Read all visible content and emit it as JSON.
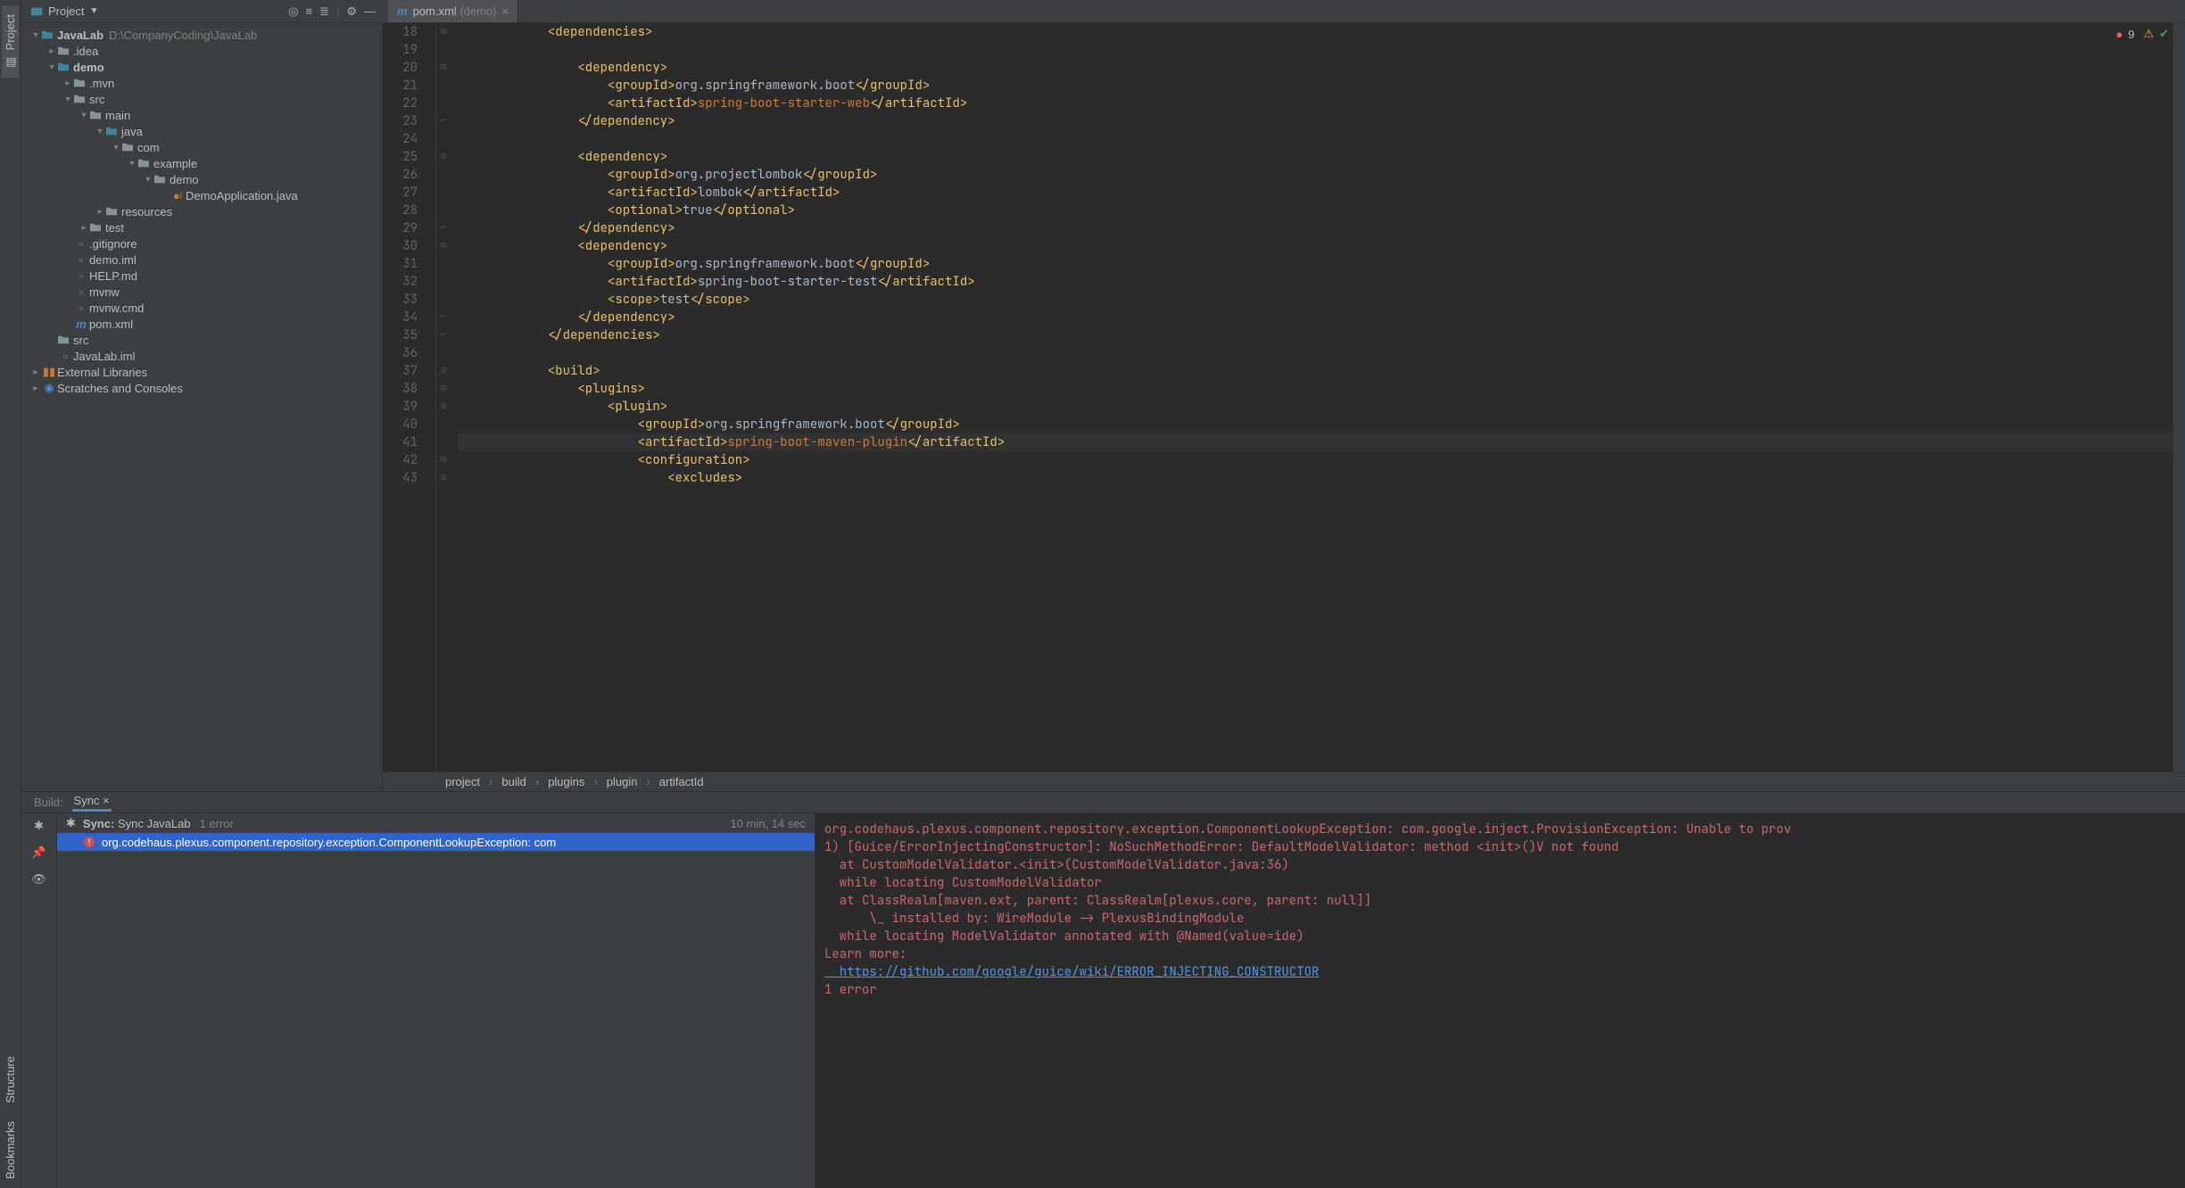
{
  "left_toolbar": {
    "project": "Project",
    "structure": "Structure",
    "bookmarks": "Bookmarks"
  },
  "topbar": {
    "project_label": "Project",
    "tab": {
      "file": "pom.xml",
      "suffix": "(demo)"
    }
  },
  "inspections": {
    "err_count": "9"
  },
  "tree": {
    "root": {
      "name": "JavaLab",
      "path": "D:\\CompanyCoding\\JavaLab"
    },
    "idea": ".idea",
    "demo": "demo",
    "mvn": ".mvn",
    "src": "src",
    "main": "main",
    "java": "java",
    "com": "com",
    "example": "example",
    "demo2": "demo",
    "demoapp": "DemoApplication.java",
    "resources": "resources",
    "test": "test",
    "gitignore": ".gitignore",
    "demoiml": "demo.iml",
    "help": "HELP.md",
    "mvnw": "mvnw",
    "mvnwcmd": "mvnw.cmd",
    "pom": "pom.xml",
    "src2": "src",
    "javalabiml": "JavaLab.iml",
    "extlib": "External Libraries",
    "scratches": "Scratches and Consoles"
  },
  "editor": {
    "lines": [
      {
        "n": 18,
        "indent": 3,
        "tokens": [
          {
            "t": "tag",
            "s": "<dependencies>"
          }
        ]
      },
      {
        "n": 19,
        "indent": 4,
        "tokens": [],
        "partial": true
      },
      {
        "n": 20,
        "indent": 4,
        "tokens": [
          {
            "t": "tag",
            "s": "<dependency>"
          }
        ]
      },
      {
        "n": 21,
        "indent": 5,
        "tokens": [
          {
            "t": "tag",
            "s": "<groupId>"
          },
          {
            "t": "val",
            "s": "org.springframework.boot"
          },
          {
            "t": "tag",
            "s": "</groupId>"
          }
        ]
      },
      {
        "n": 22,
        "indent": 5,
        "tokens": [
          {
            "t": "tag",
            "s": "<artifactId>"
          },
          {
            "t": "hl-orange",
            "s": "spring-boot-starter-web"
          },
          {
            "t": "tag",
            "s": "</artifactId>"
          }
        ]
      },
      {
        "n": 23,
        "indent": 4,
        "tokens": [
          {
            "t": "tag",
            "s": "</dependency>"
          }
        ]
      },
      {
        "n": 24,
        "indent": 0,
        "tokens": []
      },
      {
        "n": 25,
        "indent": 4,
        "tokens": [
          {
            "t": "tag",
            "s": "<dependency>"
          }
        ]
      },
      {
        "n": 26,
        "indent": 5,
        "tokens": [
          {
            "t": "tag",
            "s": "<groupId>"
          },
          {
            "t": "val",
            "s": "org.projectlombok"
          },
          {
            "t": "tag",
            "s": "</groupId>"
          }
        ]
      },
      {
        "n": 27,
        "indent": 5,
        "tokens": [
          {
            "t": "tag",
            "s": "<artifactId>"
          },
          {
            "t": "val",
            "s": "lombok"
          },
          {
            "t": "tag",
            "s": "</artifactId>"
          }
        ]
      },
      {
        "n": 28,
        "indent": 5,
        "tokens": [
          {
            "t": "tag",
            "s": "<optional>"
          },
          {
            "t": "val",
            "s": "true"
          },
          {
            "t": "tag",
            "s": "</optional>"
          }
        ]
      },
      {
        "n": 29,
        "indent": 4,
        "tokens": [
          {
            "t": "tag",
            "s": "</dependency>"
          }
        ]
      },
      {
        "n": 30,
        "indent": 4,
        "tokens": [
          {
            "t": "tag",
            "s": "<dependency>"
          }
        ]
      },
      {
        "n": 31,
        "indent": 5,
        "tokens": [
          {
            "t": "tag",
            "s": "<groupId>"
          },
          {
            "t": "val",
            "s": "org.springframework.boot"
          },
          {
            "t": "tag",
            "s": "</groupId>"
          }
        ]
      },
      {
        "n": 32,
        "indent": 5,
        "tokens": [
          {
            "t": "tag",
            "s": "<artifactId>"
          },
          {
            "t": "val",
            "s": "spring-boot-starter-test"
          },
          {
            "t": "tag",
            "s": "</artifactId>"
          }
        ]
      },
      {
        "n": 33,
        "indent": 5,
        "tokens": [
          {
            "t": "tag",
            "s": "<scope>"
          },
          {
            "t": "val",
            "s": "test"
          },
          {
            "t": "tag",
            "s": "</scope>"
          }
        ]
      },
      {
        "n": 34,
        "indent": 4,
        "tokens": [
          {
            "t": "tag",
            "s": "</dependency>"
          }
        ]
      },
      {
        "n": 35,
        "indent": 3,
        "tokens": [
          {
            "t": "tag",
            "s": "</dependencies>"
          }
        ]
      },
      {
        "n": 36,
        "indent": 0,
        "tokens": []
      },
      {
        "n": 37,
        "indent": 3,
        "tokens": [
          {
            "t": "tag",
            "s": "<build>"
          }
        ]
      },
      {
        "n": 38,
        "indent": 4,
        "tokens": [
          {
            "t": "tag",
            "s": "<plugins>"
          }
        ]
      },
      {
        "n": 39,
        "indent": 5,
        "tokens": [
          {
            "t": "tag",
            "s": "<plugin>"
          }
        ]
      },
      {
        "n": 40,
        "indent": 6,
        "tokens": [
          {
            "t": "tag",
            "s": "<groupId>"
          },
          {
            "t": "val",
            "s": "org.springframework.boot"
          },
          {
            "t": "tag",
            "s": "</groupId>"
          }
        ]
      },
      {
        "n": 41,
        "indent": 6,
        "tokens": [
          {
            "t": "tag",
            "s": "<artifactId>"
          },
          {
            "t": "hl-orange",
            "s": "spring-boot-maven-plugin"
          },
          {
            "t": "tag",
            "s": "</artifactId>"
          }
        ],
        "current": true
      },
      {
        "n": 42,
        "indent": 6,
        "tokens": [
          {
            "t": "tag",
            "s": "<configuration>"
          }
        ]
      },
      {
        "n": 43,
        "indent": 7,
        "tokens": [
          {
            "t": "tag",
            "s": "<excludes>"
          }
        ]
      }
    ],
    "first_visible_line": 18
  },
  "breadcrumbs": [
    "project",
    "build",
    "plugins",
    "plugin",
    "artifactId"
  ],
  "build": {
    "build_label": "Build:",
    "sync_label": "Sync",
    "sync_head": {
      "label_prefix": "Sync:",
      "label_text": "Sync JavaLab",
      "count": "1 error",
      "time": "10 min, 14 sec"
    },
    "error_line": "org.codehaus.plexus.component.repository.exception.ComponentLookupException: com",
    "console": [
      "org.codehaus.plexus.component.repository.exception.ComponentLookupException: com.google.inject.ProvisionException: Unable to prov",
      "",
      "1) [Guice/ErrorInjectingConstructor]: NoSuchMethodError: DefaultModelValidator: method <init>()V not found",
      "  at CustomModelValidator.<init>(CustomModelValidator.java:36)",
      "  while locating CustomModelValidator",
      "  at ClassRealm[maven.ext, parent: ClassRealm[plexus.core, parent: null]]",
      "      \\_ installed by: WireModule -> PlexusBindingModule",
      "  while locating ModelValidator annotated with @Named(value=ide)",
      "",
      "Learn more:",
      {
        "link": "  https://github.com/google/guice/wiki/ERROR_INJECTING_CONSTRUCTOR"
      },
      "",
      "1 error"
    ]
  }
}
